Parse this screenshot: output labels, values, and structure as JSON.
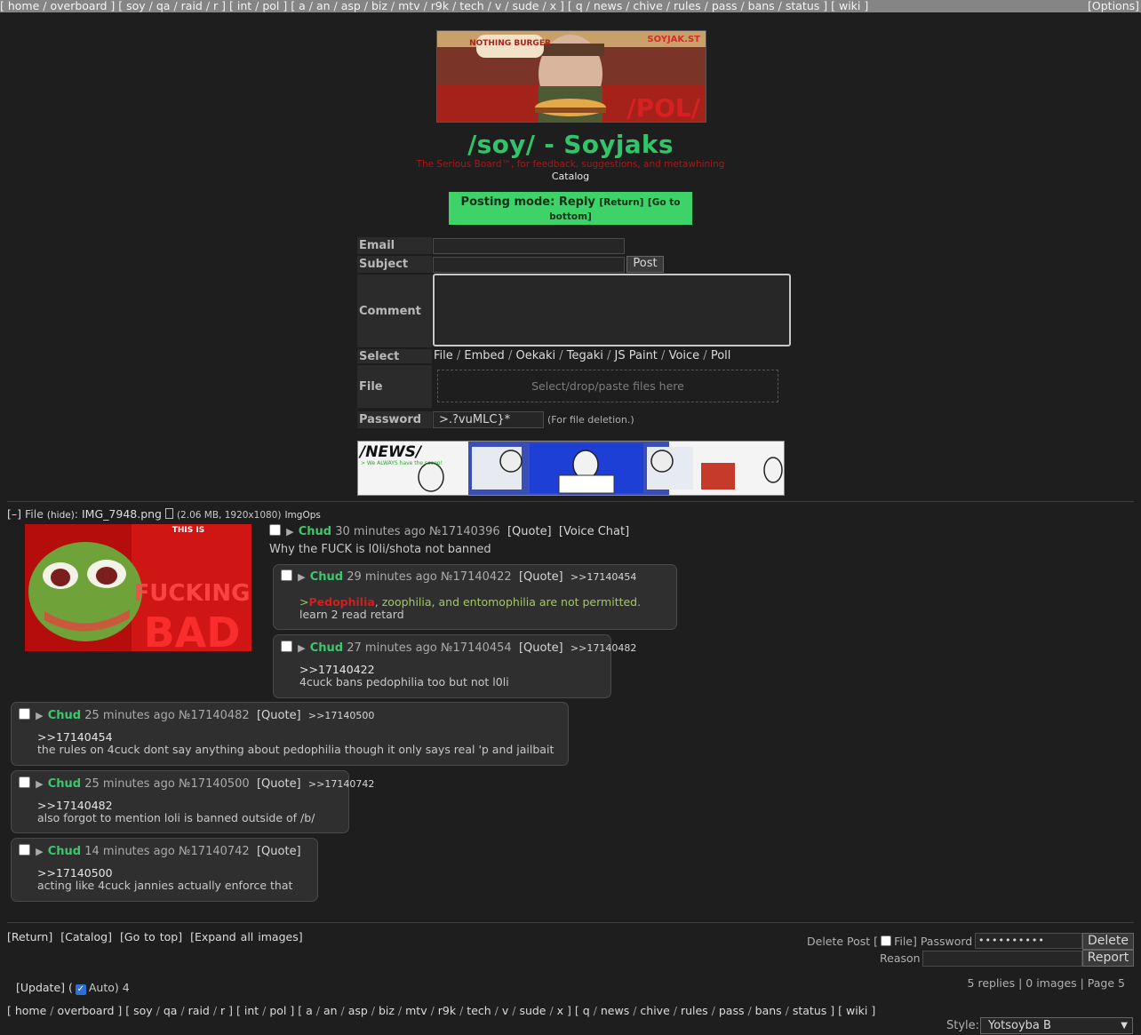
{
  "topnav": {
    "groups": [
      [
        "home",
        "overboard"
      ],
      [
        "soy",
        "qa",
        "raid",
        "r"
      ],
      [
        "int",
        "pol"
      ],
      [
        "a",
        "an",
        "asp",
        "biz",
        "mtv",
        "r9k",
        "tech",
        "v",
        "sude",
        "x"
      ],
      [
        "q",
        "news",
        "chive",
        "rules",
        "pass",
        "bans",
        "status"
      ],
      [
        "wiki"
      ]
    ],
    "options_label": "[Options]"
  },
  "banner": {
    "top_text": "NOTHING BURGER",
    "corner_text": "SOYJAK.ST",
    "board_text": "/POL/"
  },
  "header": {
    "title": "/soy/ - Soyjaks",
    "subtitle": "The Serious Board™, for feedback, suggestions, and metawhining",
    "catalog": "Catalog"
  },
  "posting_mode": {
    "label": "Posting mode: Reply",
    "return_label": "[Return]",
    "bottom_label": "[Go to bottom]"
  },
  "form": {
    "email_label": "Email",
    "subject_label": "Subject",
    "post_button": "Post",
    "comment_label": "Comment",
    "select_label": "Select",
    "select_options": [
      "File",
      "Embed",
      "Oekaki",
      "Tegaki",
      "JS Paint",
      "Voice",
      "Poll"
    ],
    "file_label": "File",
    "dropzone_text": "Select/drop/paste files here",
    "password_label": "Password",
    "password_value": ">.?vuMLC}*",
    "password_note": "(For file deletion.)"
  },
  "news_banner": {
    "title": "/NEWS/",
    "tagline": "> We ALWAYS have the scoop!"
  },
  "thread": {
    "file_info": {
      "toggle": "[–]",
      "file_label": "File",
      "hide_label": "(hide)",
      "filename": "IMG_7948.png",
      "size_info": "(2.06 MB, 1920x1080)",
      "imgops": "ImgOps"
    },
    "thumb_text": {
      "line1": "THIS IS",
      "line2": "FUCKING",
      "line3": "BAD"
    },
    "op": {
      "name": "Chud",
      "time": "30 minutes ago",
      "number": "№17140396",
      "quote": "[Quote]",
      "voice_chat": "[Voice Chat]",
      "body": "Why the FUCK is l0li/shota not banned"
    },
    "replies": [
      {
        "name": "Chud",
        "time": "29 minutes ago",
        "number": "№17140422",
        "quote": "[Quote]",
        "backlink": ">>17140454",
        "red_prefix": ">",
        "red_word": "Pedophilia",
        "green_rest": ", zoophilia, and entomophilia are not permitted.",
        "line2": "learn 2 read retard"
      },
      {
        "name": "Chud",
        "time": "27 minutes ago",
        "number": "№17140454",
        "quote": "[Quote]",
        "backlink": ">>17140482",
        "quotelink": ">>17140422",
        "line2": "4cuck bans pedophilia too but not l0li"
      },
      {
        "name": "Chud",
        "time": "25 minutes ago",
        "number": "№17140482",
        "quote": "[Quote]",
        "backlink": ">>17140500",
        "quotelink": ">>17140454",
        "line2": "the rules on 4cuck dont say anything about pedophilia though it only says real 'p and jailbait"
      },
      {
        "name": "Chud",
        "time": "25 minutes ago",
        "number": "№17140500",
        "quote": "[Quote]",
        "backlink": ">>17140742",
        "quotelink": ">>17140482",
        "line2": "also forgot to mention loli is banned outside of /b/"
      },
      {
        "name": "Chud",
        "time": "14 minutes ago",
        "number": "№17140742",
        "quote": "[Quote]",
        "quotelink": ">>17140500",
        "line2": "acting like 4cuck jannies actually enforce that"
      }
    ]
  },
  "bottom": {
    "links": [
      "[Return]",
      "[Catalog]",
      "[Go to top]",
      "[Expand all images]"
    ],
    "delete_post_label": "Delete Post [",
    "file_label": "File] Password",
    "password_dots": "••••••••••",
    "delete_button": "Delete",
    "reason_label": "Reason",
    "report_button": "Report",
    "update_label": "[Update] (",
    "auto_label": "Auto) 4",
    "stats": "5 replies | 0 images | Page 5",
    "style_label": "Style:",
    "style_value": "Yotsoyba B"
  },
  "colors": {
    "name_green": "#3cc76d",
    "title_green": "#31c56a",
    "posting_mode_bg": "#3dd369",
    "greentext": "#a3c95a",
    "redtext": "#cf1f1f"
  }
}
